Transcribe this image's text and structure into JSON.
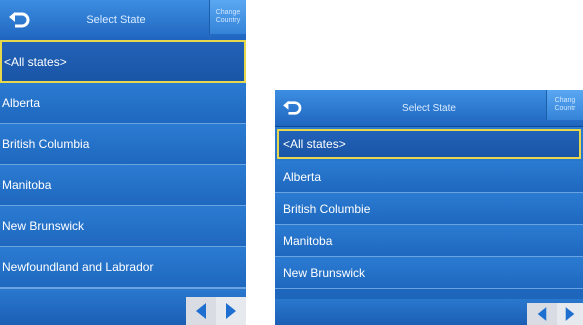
{
  "screens": [
    {
      "title": "Select State",
      "change_country": [
        "Change",
        "Country"
      ],
      "items": [
        {
          "label": "<All states>",
          "selected": true
        },
        {
          "label": "Alberta",
          "selected": false
        },
        {
          "label": "British Columbia",
          "selected": false
        },
        {
          "label": "Manitoba",
          "selected": false
        },
        {
          "label": "New Brunswick",
          "selected": false
        },
        {
          "label": "Newfoundland and Labrador",
          "selected": false
        }
      ]
    },
    {
      "title": "Select State",
      "change_country": [
        "Chang",
        "Countr"
      ],
      "items": [
        {
          "label": "<All states>",
          "selected": true
        },
        {
          "label": "Alberta",
          "selected": false
        },
        {
          "label": "British Columbie",
          "selected": false
        },
        {
          "label": "Manitoba",
          "selected": false
        },
        {
          "label": "New Brunswick",
          "selected": false
        }
      ]
    }
  ],
  "icons": {
    "back": "back-arrow-icon",
    "prev": "arrow-left-icon",
    "next": "arrow-right-icon"
  },
  "colors": {
    "highlight": "#e6d84a",
    "nav_arrow": "#1f6fd0"
  }
}
